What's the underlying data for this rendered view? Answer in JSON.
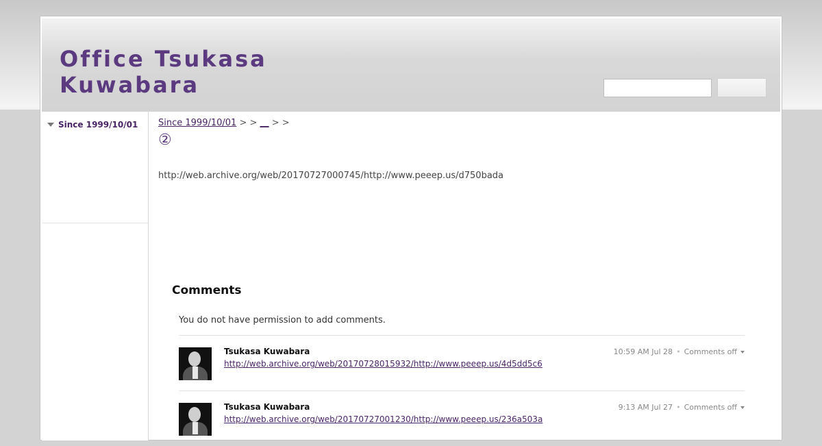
{
  "header": {
    "site_title": "Office Tsukasa Kuwabara",
    "search_placeholder": "",
    "search_button_label": ""
  },
  "sidebar": {
    "items": [
      {
        "label": "Since 1999/10/01",
        "icon": "triangle-down-icon"
      }
    ]
  },
  "breadcrumb": {
    "home": "Since 1999/10/01",
    "separator": ">",
    "items": [
      "",
      "__",
      ""
    ]
  },
  "page": {
    "title": "②",
    "content": "http://web.archive.org/web/20170727000745/http://www.peeep.us/d750bada"
  },
  "comments": {
    "heading": "Comments",
    "permission_notice": "You do not have permission to add comments.",
    "items": [
      {
        "author": "Tsukasa Kuwabara",
        "link": "http://web.archive.org/web/20170728015932/http://www.peeep.us/4d5dd5c6",
        "time": "10:59 AM Jul 28",
        "status": "Comments off"
      },
      {
        "author": "Tsukasa Kuwabara",
        "link": "http://web.archive.org/web/20170727001230/http://www.peeep.us/236a503a",
        "time": "9:13 AM Jul 27",
        "status": "Comments off"
      }
    ]
  },
  "colors": {
    "brand": "#5b3a80",
    "link": "#4a2566",
    "background": "#d3d3d3"
  }
}
